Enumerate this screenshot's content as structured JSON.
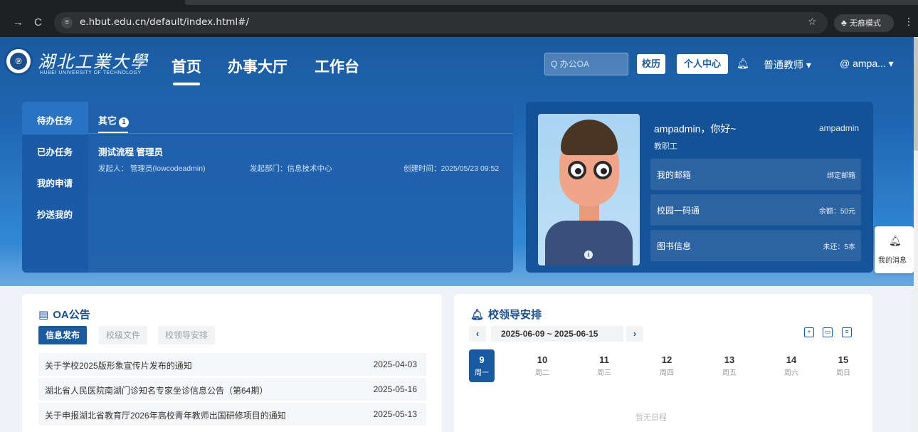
{
  "browser": {
    "back_icon": "→",
    "reload_icon": "C",
    "url": "e.hbut.edu.cn/default/index.html#/",
    "incognito_label": "无痕模式"
  },
  "header": {
    "logo_text": "湖北工業大學",
    "logo_sub": "HUBEI UNIVERSITY OF TECHNOLOGY",
    "nav": [
      "首页",
      "办事大厅",
      "工作台"
    ],
    "search_placeholder": "Q 办公OA",
    "calendar_btn": "校历",
    "personal_btn": "个人中心",
    "role": "普通教师 ▾",
    "user": "@ ampa... ▾"
  },
  "tasks": {
    "side_items": [
      "待办任务",
      "已办任务",
      "我的申请",
      "抄送我的"
    ],
    "tab_label": "其它",
    "tab_count": "1",
    "task_name": "测试流程 管理员",
    "initiator": "发起人： 管理员(lowcodeadmin)",
    "department": "发起部门：信息技术中心",
    "created": "创建时间：2025/05/23 09:52"
  },
  "profile": {
    "greeting": "ampadmin，你好~",
    "username": "ampadmin",
    "user_type": "教职工",
    "rows": [
      {
        "label": "我的邮箱",
        "value": "绑定邮箱"
      },
      {
        "label": "校园一码通",
        "value": "余额：50元"
      },
      {
        "label": "图书信息",
        "value": "未还：5本"
      }
    ]
  },
  "float_msg": {
    "label": "我的消息"
  },
  "oa": {
    "title": "OA公告",
    "tabs": [
      "信息发布",
      "校级文件",
      "校领导安排"
    ],
    "notices": [
      {
        "title": "关于学校2025版形象宣传片发布的通知",
        "date": "2025-04-03"
      },
      {
        "title": "湖北省人民医院南湖门诊知名专家坐诊信息公告（第64期）",
        "date": "2025-05-16"
      },
      {
        "title": "关于申报湖北省教育厅2026年高校青年教师出国研修项目的通知",
        "date": "2025-05-13"
      }
    ]
  },
  "leader": {
    "title": "校领导安排",
    "week_range": "2025-06-09 ~ 2025-06-15",
    "days": [
      {
        "n": "9",
        "w": "周一"
      },
      {
        "n": "10",
        "w": "周二"
      },
      {
        "n": "11",
        "w": "周三"
      },
      {
        "n": "12",
        "w": "周四"
      },
      {
        "n": "13",
        "w": "周五"
      },
      {
        "n": "14",
        "w": "周六"
      },
      {
        "n": "15",
        "w": "周日"
      }
    ],
    "empty_text": "暂无日程"
  },
  "colors": {
    "brand": "#1a5ba0",
    "chrome": "#1f2023"
  }
}
